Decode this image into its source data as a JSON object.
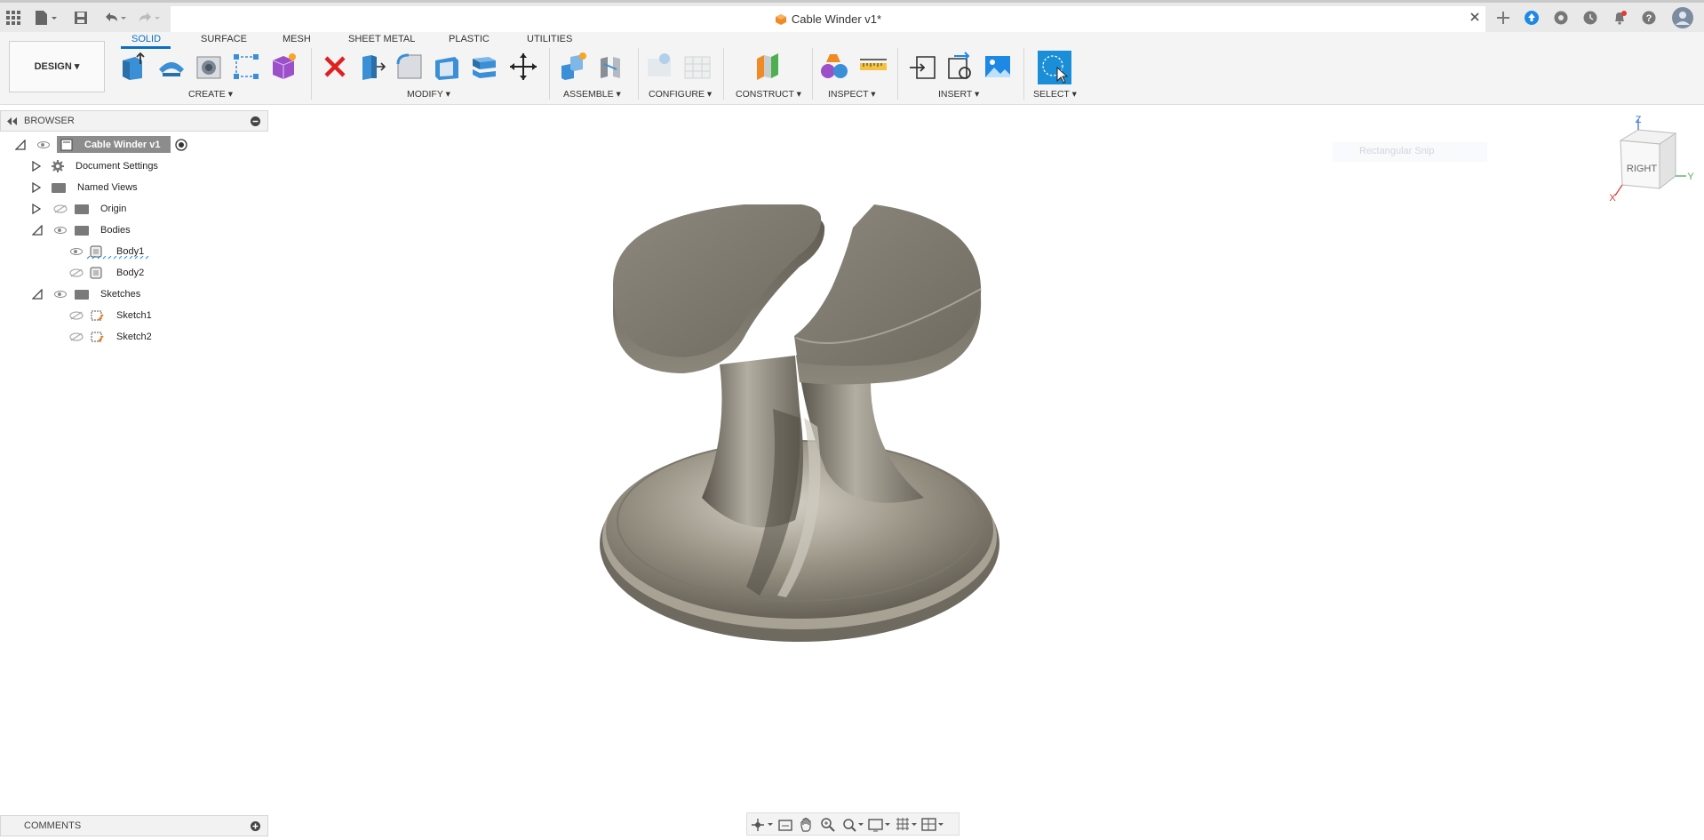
{
  "app": {
    "document_title": "Cable Winder v1*",
    "workspace": "DESIGN"
  },
  "tabs": [
    "SOLID",
    "SURFACE",
    "MESH",
    "SHEET METAL",
    "PLASTIC",
    "UTILITIES"
  ],
  "groups": {
    "create": "CREATE",
    "modify": "MODIFY",
    "assemble": "ASSEMBLE",
    "configure": "CONFIGURE",
    "construct": "CONSTRUCT",
    "inspect": "INSPECT",
    "insert": "INSERT",
    "select": "SELECT"
  },
  "browser": {
    "title": "BROWSER",
    "root": "Cable Winder v1",
    "items": {
      "document_settings": "Document Settings",
      "named_views": "Named Views",
      "origin": "Origin",
      "bodies": "Bodies",
      "body1": "Body1",
      "body2": "Body2",
      "sketches": "Sketches",
      "sketch1": "Sketch1",
      "sketch2": "Sketch2"
    }
  },
  "viewcube": {
    "face": "RIGHT",
    "axis_z": "Z",
    "axis_y": "Y",
    "axis_x": "X"
  },
  "tooltip": "Rectangular Snip",
  "comments": {
    "title": "COMMENTS"
  },
  "colors": {
    "accent": "#0a6fc2",
    "select_tool": "#1a8fd8",
    "delete": "#e02020",
    "model": "#8a8478"
  }
}
